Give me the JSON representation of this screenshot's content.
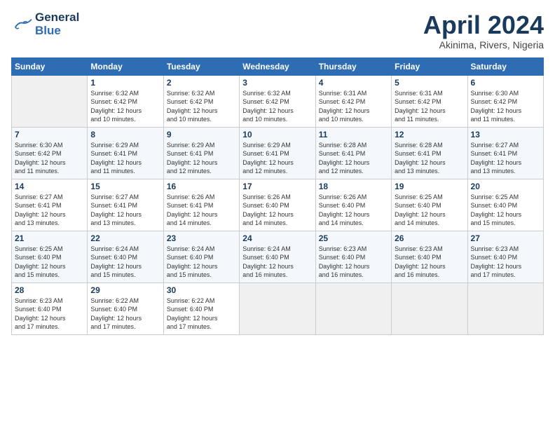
{
  "header": {
    "logo_line1": "General",
    "logo_line2": "Blue",
    "month": "April 2024",
    "location": "Akinima, Rivers, Nigeria"
  },
  "days_of_week": [
    "Sunday",
    "Monday",
    "Tuesday",
    "Wednesday",
    "Thursday",
    "Friday",
    "Saturday"
  ],
  "weeks": [
    [
      {
        "day": "",
        "info": ""
      },
      {
        "day": "1",
        "info": "Sunrise: 6:32 AM\nSunset: 6:42 PM\nDaylight: 12 hours\nand 10 minutes."
      },
      {
        "day": "2",
        "info": "Sunrise: 6:32 AM\nSunset: 6:42 PM\nDaylight: 12 hours\nand 10 minutes."
      },
      {
        "day": "3",
        "info": "Sunrise: 6:32 AM\nSunset: 6:42 PM\nDaylight: 12 hours\nand 10 minutes."
      },
      {
        "day": "4",
        "info": "Sunrise: 6:31 AM\nSunset: 6:42 PM\nDaylight: 12 hours\nand 10 minutes."
      },
      {
        "day": "5",
        "info": "Sunrise: 6:31 AM\nSunset: 6:42 PM\nDaylight: 12 hours\nand 11 minutes."
      },
      {
        "day": "6",
        "info": "Sunrise: 6:30 AM\nSunset: 6:42 PM\nDaylight: 12 hours\nand 11 minutes."
      }
    ],
    [
      {
        "day": "7",
        "info": "Sunrise: 6:30 AM\nSunset: 6:42 PM\nDaylight: 12 hours\nand 11 minutes."
      },
      {
        "day": "8",
        "info": "Sunrise: 6:29 AM\nSunset: 6:41 PM\nDaylight: 12 hours\nand 11 minutes."
      },
      {
        "day": "9",
        "info": "Sunrise: 6:29 AM\nSunset: 6:41 PM\nDaylight: 12 hours\nand 12 minutes."
      },
      {
        "day": "10",
        "info": "Sunrise: 6:29 AM\nSunset: 6:41 PM\nDaylight: 12 hours\nand 12 minutes."
      },
      {
        "day": "11",
        "info": "Sunrise: 6:28 AM\nSunset: 6:41 PM\nDaylight: 12 hours\nand 12 minutes."
      },
      {
        "day": "12",
        "info": "Sunrise: 6:28 AM\nSunset: 6:41 PM\nDaylight: 12 hours\nand 13 minutes."
      },
      {
        "day": "13",
        "info": "Sunrise: 6:27 AM\nSunset: 6:41 PM\nDaylight: 12 hours\nand 13 minutes."
      }
    ],
    [
      {
        "day": "14",
        "info": "Sunrise: 6:27 AM\nSunset: 6:41 PM\nDaylight: 12 hours\nand 13 minutes."
      },
      {
        "day": "15",
        "info": "Sunrise: 6:27 AM\nSunset: 6:41 PM\nDaylight: 12 hours\nand 13 minutes."
      },
      {
        "day": "16",
        "info": "Sunrise: 6:26 AM\nSunset: 6:41 PM\nDaylight: 12 hours\nand 14 minutes."
      },
      {
        "day": "17",
        "info": "Sunrise: 6:26 AM\nSunset: 6:40 PM\nDaylight: 12 hours\nand 14 minutes."
      },
      {
        "day": "18",
        "info": "Sunrise: 6:26 AM\nSunset: 6:40 PM\nDaylight: 12 hours\nand 14 minutes."
      },
      {
        "day": "19",
        "info": "Sunrise: 6:25 AM\nSunset: 6:40 PM\nDaylight: 12 hours\nand 14 minutes."
      },
      {
        "day": "20",
        "info": "Sunrise: 6:25 AM\nSunset: 6:40 PM\nDaylight: 12 hours\nand 15 minutes."
      }
    ],
    [
      {
        "day": "21",
        "info": "Sunrise: 6:25 AM\nSunset: 6:40 PM\nDaylight: 12 hours\nand 15 minutes."
      },
      {
        "day": "22",
        "info": "Sunrise: 6:24 AM\nSunset: 6:40 PM\nDaylight: 12 hours\nand 15 minutes."
      },
      {
        "day": "23",
        "info": "Sunrise: 6:24 AM\nSunset: 6:40 PM\nDaylight: 12 hours\nand 15 minutes."
      },
      {
        "day": "24",
        "info": "Sunrise: 6:24 AM\nSunset: 6:40 PM\nDaylight: 12 hours\nand 16 minutes."
      },
      {
        "day": "25",
        "info": "Sunrise: 6:23 AM\nSunset: 6:40 PM\nDaylight: 12 hours\nand 16 minutes."
      },
      {
        "day": "26",
        "info": "Sunrise: 6:23 AM\nSunset: 6:40 PM\nDaylight: 12 hours\nand 16 minutes."
      },
      {
        "day": "27",
        "info": "Sunrise: 6:23 AM\nSunset: 6:40 PM\nDaylight: 12 hours\nand 17 minutes."
      }
    ],
    [
      {
        "day": "28",
        "info": "Sunrise: 6:23 AM\nSunset: 6:40 PM\nDaylight: 12 hours\nand 17 minutes."
      },
      {
        "day": "29",
        "info": "Sunrise: 6:22 AM\nSunset: 6:40 PM\nDaylight: 12 hours\nand 17 minutes."
      },
      {
        "day": "30",
        "info": "Sunrise: 6:22 AM\nSunset: 6:40 PM\nDaylight: 12 hours\nand 17 minutes."
      },
      {
        "day": "",
        "info": ""
      },
      {
        "day": "",
        "info": ""
      },
      {
        "day": "",
        "info": ""
      },
      {
        "day": "",
        "info": ""
      }
    ]
  ]
}
